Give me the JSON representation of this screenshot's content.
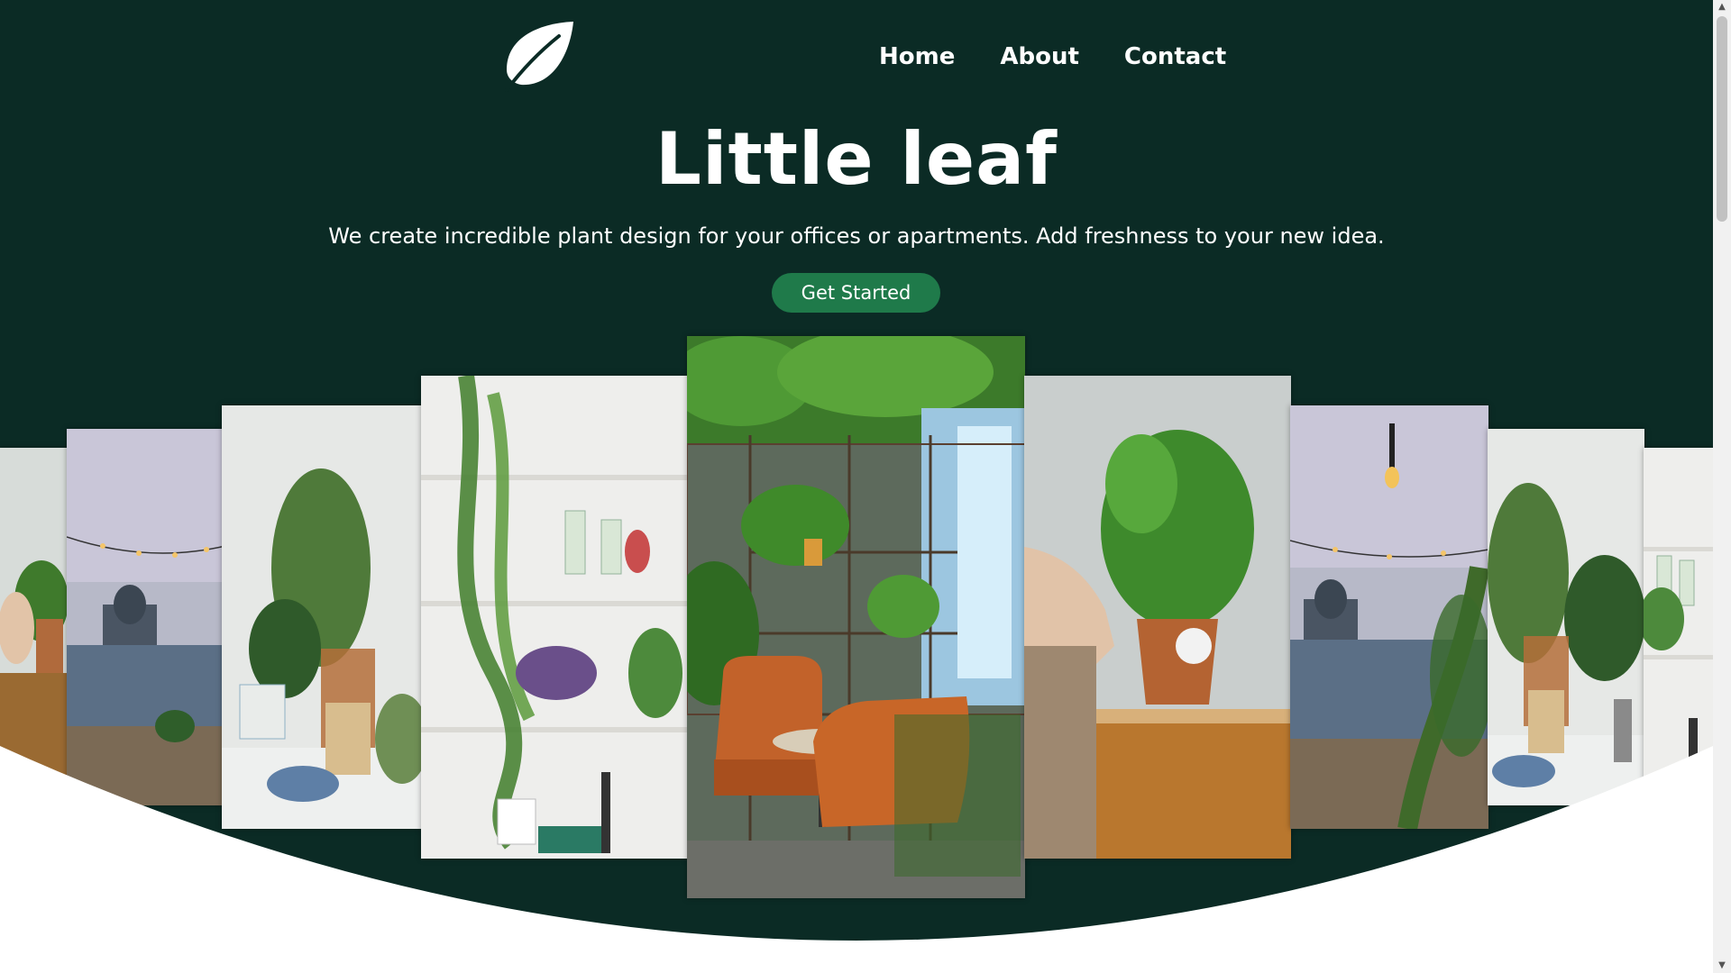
{
  "brand": {
    "logo_icon": "leaf-icon"
  },
  "nav": {
    "items": [
      {
        "label": "Home"
      },
      {
        "label": "About"
      },
      {
        "label": "Contact"
      }
    ]
  },
  "hero": {
    "title": "Little leaf",
    "subtitle": "We create incredible plant design for your offices or apartments. Add freshness to your new idea.",
    "cta_label": "Get Started"
  },
  "gallery": {
    "images": [
      {
        "name": "hands-potting-plant-photo"
      },
      {
        "name": "rooftop-string-lights-photo"
      },
      {
        "name": "room-plants-chair-photo"
      },
      {
        "name": "shelf-pothos-photo"
      },
      {
        "name": "cafe-green-ceiling-photo"
      },
      {
        "name": "hand-pot-mint-photo"
      },
      {
        "name": "rooftop-string-lights-photo"
      },
      {
        "name": "room-plants-chair-photo"
      },
      {
        "name": "shelf-pothos-photo"
      }
    ]
  },
  "colors": {
    "background": "#0b2b25",
    "accent": "#1f7a4a",
    "text": "#ffffff"
  }
}
